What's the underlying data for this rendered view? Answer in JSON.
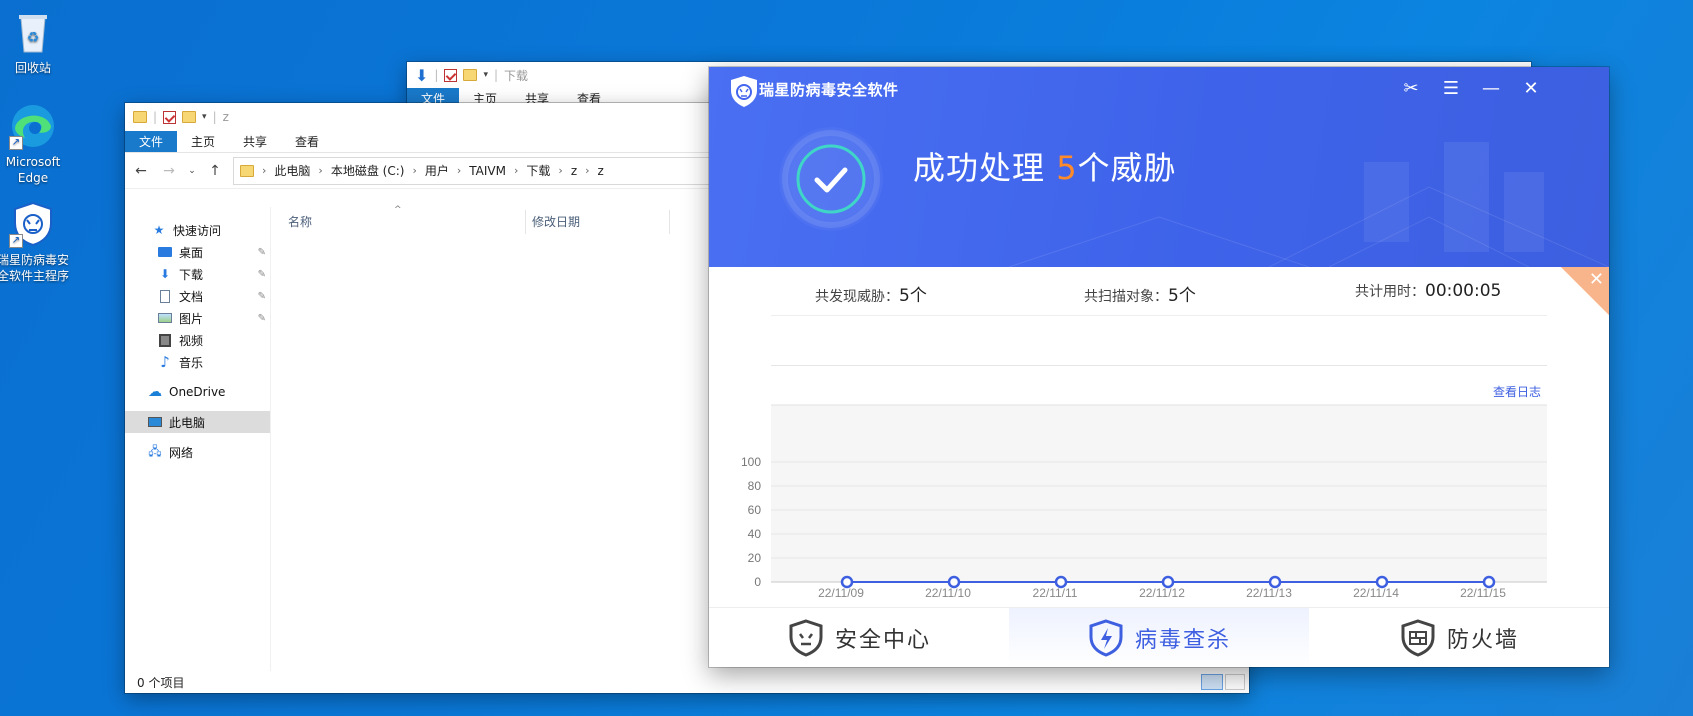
{
  "desktop": {
    "icons": [
      {
        "label": "回收站"
      },
      {
        "label": "Microsoft Edge"
      },
      {
        "label": "瑞星防病毒安全软件主程序"
      }
    ]
  },
  "explorer_back": {
    "title": "下载",
    "ribbon_tabs": [
      "文件",
      "主页",
      "共享",
      "查看"
    ]
  },
  "explorer": {
    "title": "z",
    "ribbon_tabs": [
      "文件",
      "主页",
      "共享",
      "查看"
    ],
    "breadcrumb": [
      "此电脑",
      "本地磁盘 (C:)",
      "用户",
      "TAIVM",
      "下载",
      "z",
      "z"
    ],
    "columns": [
      "名称",
      "修改日期"
    ],
    "nav": {
      "quick_access": "快速访问",
      "items": [
        "桌面",
        "下载",
        "文档",
        "图片",
        "视频",
        "音乐"
      ],
      "onedrive": "OneDrive",
      "this_pc": "此电脑",
      "network": "网络"
    },
    "status": "0 个项目"
  },
  "antivirus": {
    "title": "瑞星防病毒安全软件",
    "headline_pre": "成功处理",
    "headline_num": "5",
    "headline_post": "个威胁",
    "summary": {
      "threats_label": "共发现威胁：",
      "threats_value": "5个",
      "scanned_label": "共扫描对象：",
      "scanned_value": "5个",
      "time_label": "共计用时：",
      "time_value": "00:00:05"
    },
    "view_log": "查看日志",
    "bottom_nav": [
      "安全中心",
      "病毒查杀",
      "防火墙"
    ],
    "accent": "#3d5fe0",
    "highlight": "#ff8a2a"
  },
  "chart_data": {
    "type": "line",
    "categories": [
      "22/11/09",
      "22/11/10",
      "22/11/11",
      "22/11/12",
      "22/11/13",
      "22/11/14",
      "22/11/15"
    ],
    "values": [
      0,
      0,
      0,
      0,
      0,
      0,
      0
    ],
    "yticks": [
      0,
      20,
      40,
      60,
      80,
      100
    ],
    "ylim": [
      0,
      100
    ],
    "grid": true
  }
}
